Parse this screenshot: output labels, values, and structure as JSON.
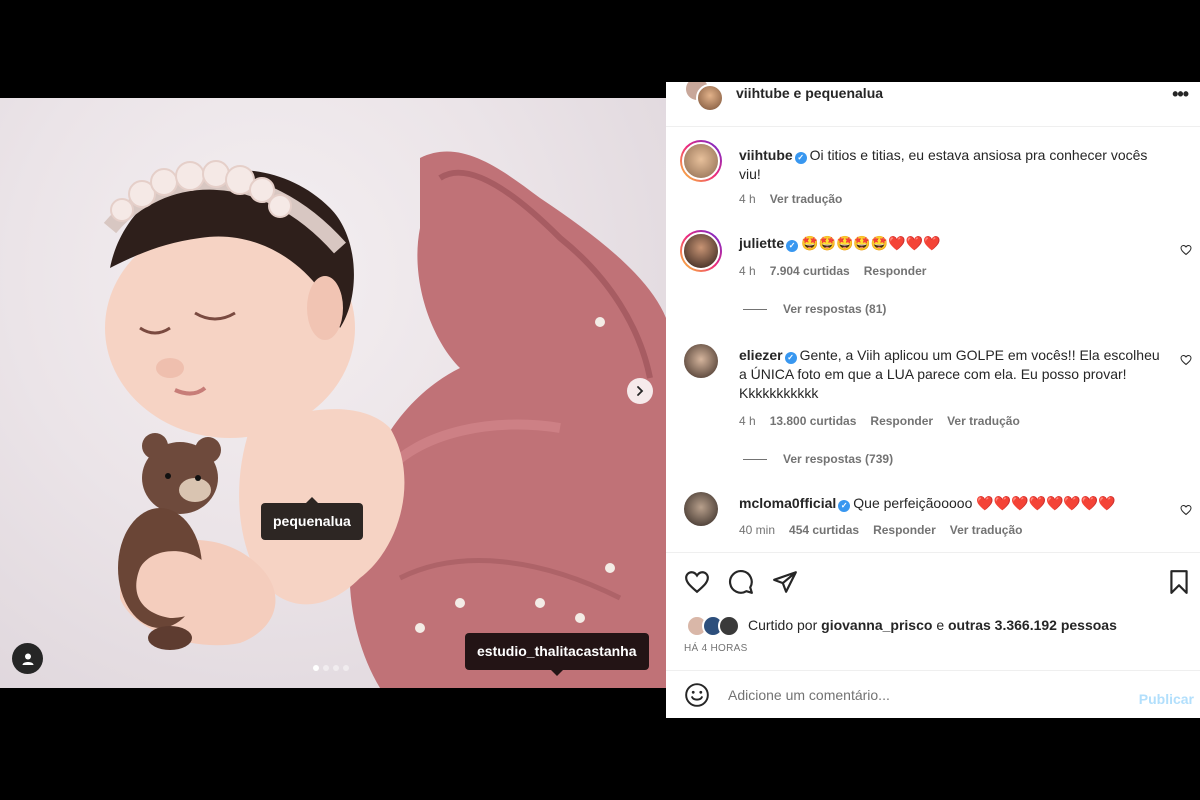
{
  "post": {
    "photo_tags": [
      "pequenalua",
      "estudio_thalitacastanha"
    ],
    "carousel": {
      "count": 4,
      "active": 1
    },
    "header_name": "viihtube e pequenalua",
    "more_icon": "more-horizontal-icon"
  },
  "caption": {
    "user": "viihtube",
    "verified": true,
    "text": "Oi titios e titias, eu estava ansiosa pra conhecer vocês viu!",
    "time": "4 h",
    "translate": "Ver tradução"
  },
  "comments": [
    {
      "user": "juliette",
      "verified": true,
      "emoji": "🤩🤩🤩🤩🤩❤️❤️❤️",
      "time": "4 h",
      "likes": "7.904 curtidas",
      "reply": "Responder",
      "view_replies": "Ver respostas (81)"
    },
    {
      "user": "eliezer",
      "verified": true,
      "text": "Gente, a Viih aplicou um GOLPE em vocês!! Ela escolheu a ÚNICA foto em que a LUA parece com ela. Eu posso provar! Kkkkkkkkkkk",
      "time": "4 h",
      "likes": "13.800 curtidas",
      "reply": "Responder",
      "translate": "Ver tradução",
      "view_replies": "Ver respostas (739)"
    },
    {
      "user": "mcloma0fficial",
      "verified": true,
      "text": "Que perfeiçãooooo",
      "emoji": "❤️❤️❤️❤️❤️❤️❤️❤️",
      "time": "40 min",
      "likes": "454 curtidas",
      "reply": "Responder",
      "translate": "Ver tradução"
    }
  ],
  "likes_summary": {
    "prefix": "Curtido por",
    "user": "giovanna_prisco",
    "connector": "e",
    "others": "outras 3.366.192 pessoas"
  },
  "time_ago": "HÁ 4 HORAS",
  "add_comment": {
    "placeholder": "Adicione um comentário...",
    "publish": "Publicar"
  },
  "colors": {
    "verified": "#3897f0",
    "publish_disabled": "#b2dffc",
    "heart_emoji": "#e0245e"
  }
}
